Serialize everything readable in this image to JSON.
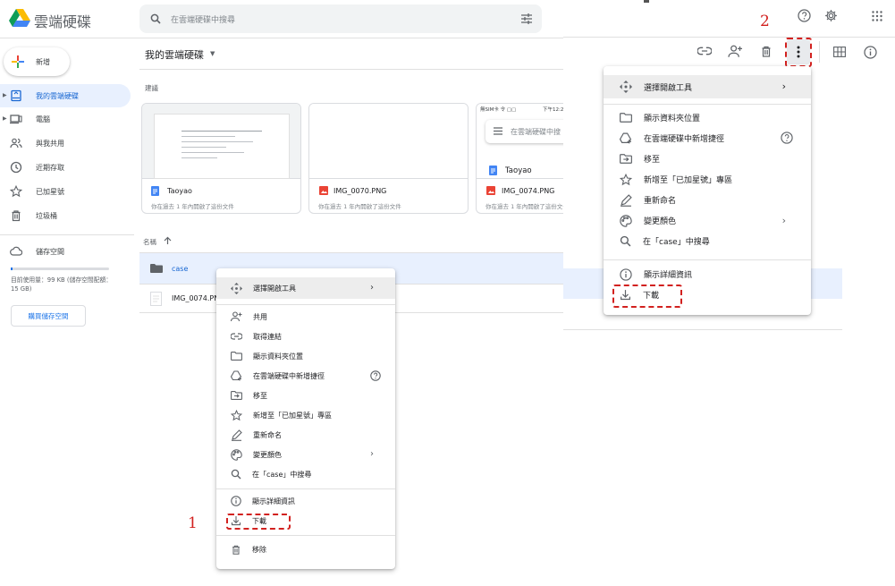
{
  "app": {
    "title": "雲端硬碟",
    "search_placeholder": "在雲端硬碟中搜尋",
    "new_button": "新增",
    "sidebar": [
      {
        "label": "我的雲端硬碟",
        "icon": "drive-icon",
        "active": true
      },
      {
        "label": "電腦",
        "icon": "computer-icon"
      },
      {
        "label": "與我共用",
        "icon": "people-icon"
      },
      {
        "label": "近期存取",
        "icon": "clock-icon"
      },
      {
        "label": "已加星號",
        "icon": "star-icon"
      },
      {
        "label": "垃圾桶",
        "icon": "trash-icon"
      }
    ],
    "storage": {
      "label": "儲存空間",
      "used_text": "目前使用量：99 KB (儲存空間配額：15 GB)",
      "buy_button": "購買儲存空間"
    },
    "breadcrumb": "我的雲端硬碟",
    "suggested_label": "建議",
    "suggested": [
      {
        "name": "Taoyao",
        "subtitle": "你在過去 1 年內開啟了這份文件",
        "type": "doc"
      },
      {
        "name": "IMG_0070.PNG",
        "subtitle": "你在過去 1 年內開啟了這份文件",
        "type": "image"
      },
      {
        "name": "IMG_0074.PNG",
        "subtitle": "你在過去 1 年內開啟了這份文件",
        "type": "image",
        "thumb": {
          "status": "無SIM卡 令 ▢▢",
          "time": "下午12:2",
          "search": "在雲端硬碟中搜",
          "doc": "Taoyao"
        }
      }
    ],
    "name_header": "名稱",
    "files": [
      {
        "name": "case",
        "type": "folder",
        "selected": true
      },
      {
        "name": "IMG_0074.PN",
        "type": "image"
      }
    ]
  },
  "context_menu": {
    "open_with": "選擇開啟工具",
    "share": "共用",
    "get_link": "取得連結",
    "show_location": "顯示資料夾位置",
    "add_shortcut": "在雲端硬碟中新增捷徑",
    "move_to": "移至",
    "add_star": "新增至「已加星號」專區",
    "rename": "重新命名",
    "change_color": "變更顏色",
    "search_in": "在「case」中搜尋",
    "view_details": "顯示詳細資訊",
    "download": "下載",
    "remove": "移除"
  },
  "right_menu": {
    "open_with": "選擇開啟工具",
    "show_location": "顯示資料夾位置",
    "add_shortcut": "在雲端硬碟中新增捷徑",
    "move_to": "移至",
    "add_star": "新增至「已加星號」專區",
    "rename": "重新命名",
    "change_color": "變更顏色",
    "search_in": "在「case」中搜尋",
    "view_details": "顯示詳細資訊",
    "download": "下載"
  },
  "annotations": {
    "step1": "1",
    "step2": "2"
  },
  "colors": {
    "accent": "#1a73e8",
    "annotation": "#d2211f",
    "selected_row": "#e8f0fe"
  }
}
